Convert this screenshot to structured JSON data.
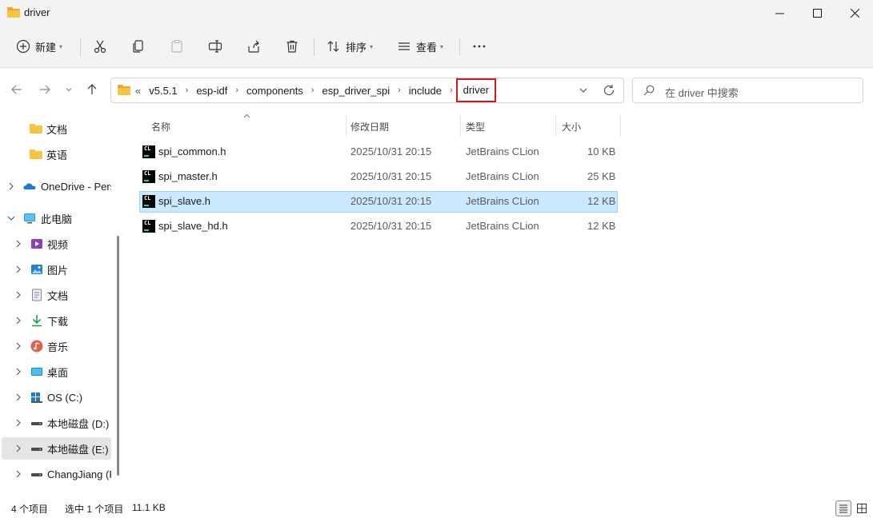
{
  "window": {
    "title": "driver"
  },
  "toolbar": {
    "new_label": "新建",
    "sort_label": "排序",
    "view_label": "查看"
  },
  "address": {
    "overflow": "«",
    "crumbs": [
      "v5.5.1",
      "esp-idf",
      "components",
      "esp_driver_spi",
      "include"
    ],
    "current": "driver"
  },
  "search": {
    "placeholder": "在 driver 中搜索"
  },
  "sidebar": {
    "items": [
      {
        "label": "文档",
        "icon": "folder-icon"
      },
      {
        "label": "英语",
        "icon": "folder-icon"
      },
      {
        "label": "OneDrive - Pers",
        "icon": "onedrive-icon"
      },
      {
        "label": "此电脑",
        "icon": "computer-icon"
      },
      {
        "label": "视频",
        "icon": "video-icon"
      },
      {
        "label": "图片",
        "icon": "picture-icon"
      },
      {
        "label": "文档",
        "icon": "document-icon"
      },
      {
        "label": "下载",
        "icon": "download-icon"
      },
      {
        "label": "音乐",
        "icon": "music-icon"
      },
      {
        "label": "桌面",
        "icon": "desktop-icon"
      },
      {
        "label": "OS (C:)",
        "icon": "windows-drive-icon"
      },
      {
        "label": "本地磁盘 (D:)",
        "icon": "drive-icon"
      },
      {
        "label": "本地磁盘 (E:)",
        "icon": "drive-icon"
      },
      {
        "label": "ChangJiang (F",
        "icon": "drive-icon"
      }
    ]
  },
  "columns": {
    "name": "名称",
    "modified": "修改日期",
    "type": "类型",
    "size": "大小"
  },
  "files": [
    {
      "name": "spi_common.h",
      "modified": "2025/10/31 20:15",
      "type": "JetBrains CLion",
      "size": "10 KB",
      "icon_text": "CL"
    },
    {
      "name": "spi_master.h",
      "modified": "2025/10/31 20:15",
      "type": "JetBrains CLion",
      "size": "25 KB",
      "icon_text": "CL"
    },
    {
      "name": "spi_slave.h",
      "modified": "2025/10/31 20:15",
      "type": "JetBrains CLion",
      "size": "12 KB",
      "icon_text": "CL"
    },
    {
      "name": "spi_slave_hd.h",
      "modified": "2025/10/31 20:15",
      "type": "JetBrains CLion",
      "size": "12 KB",
      "icon_text": "CL"
    }
  ],
  "status": {
    "count": "4 个项目",
    "selected": "选中 1 个项目",
    "size": "11.1 KB"
  },
  "colors": {
    "selection_bg": "#cce8ff",
    "selection_border": "#99d1ff",
    "highlight_red": "#d0181f",
    "folder_yellow": "#f6c344"
  }
}
